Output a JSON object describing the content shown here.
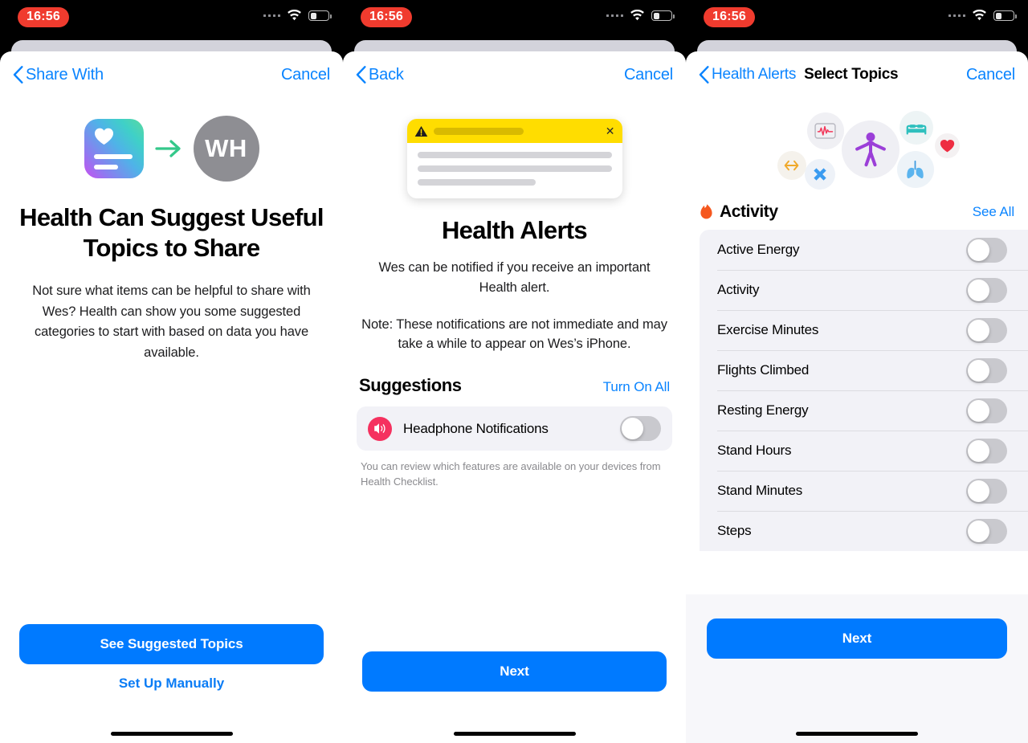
{
  "status_bar": {
    "time": "16:56",
    "time_pill_color": "#F03B2E",
    "signal_icon": "cellular-signal-icon",
    "wifi_icon": "wifi-icon",
    "battery_icon": "battery-icon"
  },
  "accent_color": "#007aff",
  "link_color": "#0a84ff",
  "screens": [
    {
      "id": "share-with",
      "nav": {
        "back_icon": "chevron-left-icon",
        "back_label": "Share With",
        "title": "",
        "cancel_label": "Cancel"
      },
      "hero": {
        "app_icon": "health-card-icon",
        "arrow_icon": "arrow-right-icon",
        "avatar_initials": "WH"
      },
      "title": "Health Can Suggest Useful Topics to Share",
      "body": "Not sure what items can be helpful to share with Wes? Health can show you some suggested categories to start with based on data you have available.",
      "primary_button": "See Suggested Topics",
      "secondary_button": "Set Up Manually"
    },
    {
      "id": "health-alerts",
      "nav": {
        "back_icon": "chevron-left-icon",
        "back_label": "Back",
        "title": "",
        "cancel_label": "Cancel"
      },
      "alert_card": {
        "warning_icon": "warning-triangle-icon",
        "close_icon": "close-icon",
        "banner_color": "#FFDD00"
      },
      "title": "Health Alerts",
      "body": "Wes can be notified if you receive an important Health alert.",
      "note": "Note: These notifications are not immediate and may take a while to appear on Wes’s iPhone.",
      "section": {
        "title": "Suggestions",
        "action": "Turn On All"
      },
      "suggestion_row": {
        "icon": "headphone-audio-icon",
        "icon_color": "#F5315F",
        "label": "Headphone Notifications",
        "toggle_on": false
      },
      "footnote": "You can review which features are available on your devices from Health Checklist.",
      "primary_button": "Next"
    },
    {
      "id": "select-topics",
      "nav": {
        "back_icon": "chevron-left-icon",
        "back_label": "Health Alerts",
        "title": "Select Topics",
        "cancel_label": "Cancel"
      },
      "illustration_icons": [
        "heart-rate-monitor-icon",
        "accessibility-body-icon",
        "bed-sleep-icon",
        "heart-icon",
        "lungs-icon",
        "medical-cross-icon",
        "arrows-horizontal-icon"
      ],
      "section": {
        "icon": "flame-icon",
        "title": "Activity",
        "action": "See All"
      },
      "topics": [
        {
          "label": "Active Energy",
          "toggle_on": false
        },
        {
          "label": "Activity",
          "toggle_on": false
        },
        {
          "label": "Exercise Minutes",
          "toggle_on": false
        },
        {
          "label": "Flights Climbed",
          "toggle_on": false
        },
        {
          "label": "Resting Energy",
          "toggle_on": false
        },
        {
          "label": "Stand Hours",
          "toggle_on": false
        },
        {
          "label": "Stand Minutes",
          "toggle_on": false
        },
        {
          "label": "Steps",
          "toggle_on": false
        }
      ],
      "primary_button": "Next"
    }
  ]
}
